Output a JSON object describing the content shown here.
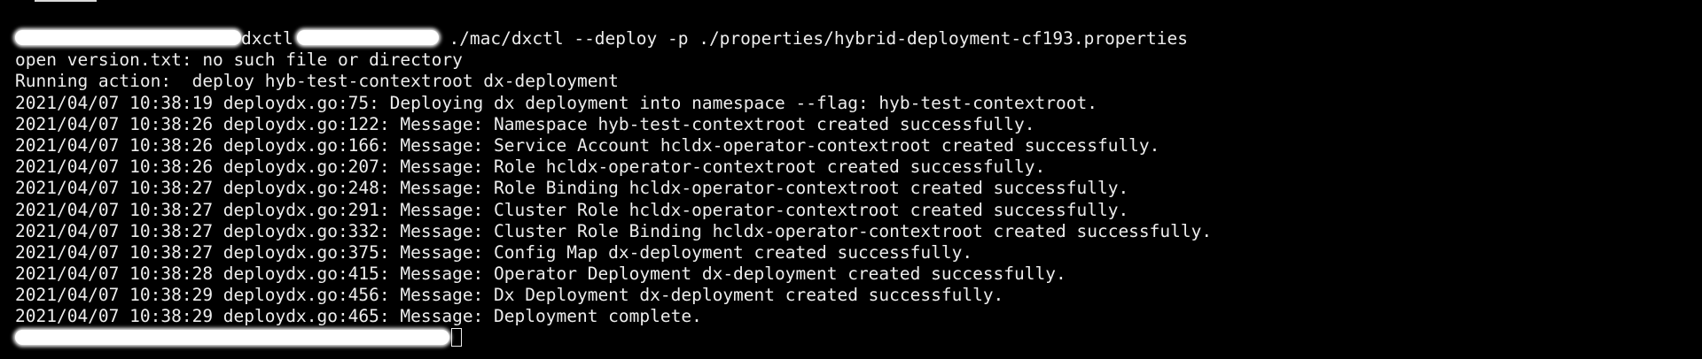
{
  "terminal": {
    "command_prefix": "dxctl",
    "command_args": " ./mac/dxctl --deploy -p ./properties/hybrid-deployment-cf193.properties",
    "output_lines": [
      "open version.txt: no such file or directory",
      "Running action:  deploy hyb-test-contextroot dx-deployment",
      "2021/04/07 10:38:19 deploydx.go:75: Deploying dx deployment into namespace --flag: hyb-test-contextroot.",
      "2021/04/07 10:38:26 deploydx.go:122: Message: Namespace hyb-test-contextroot created successfully.",
      "2021/04/07 10:38:26 deploydx.go:166: Message: Service Account hcldx-operator-contextroot created successfully.",
      "2021/04/07 10:38:26 deploydx.go:207: Message: Role hcldx-operator-contextroot created successfully.",
      "2021/04/07 10:38:27 deploydx.go:248: Message: Role Binding hcldx-operator-contextroot created successfully.",
      "2021/04/07 10:38:27 deploydx.go:291: Message: Cluster Role hcldx-operator-contextroot created successfully.",
      "2021/04/07 10:38:27 deploydx.go:332: Message: Cluster Role Binding hcldx-operator-contextroot created successfully.",
      "2021/04/07 10:38:27 deploydx.go:375: Message: Config Map dx-deployment created successfully.",
      "2021/04/07 10:38:28 deploydx.go:415: Message: Operator Deployment dx-deployment created successfully.",
      "2021/04/07 10:38:29 deploydx.go:456: Message: Dx Deployment dx-deployment created successfully.",
      "2021/04/07 10:38:29 deploydx.go:465: Message: Deployment complete."
    ],
    "colors": {
      "background": "#000000",
      "foreground": "#ededed",
      "redaction": "#ffffff"
    }
  }
}
